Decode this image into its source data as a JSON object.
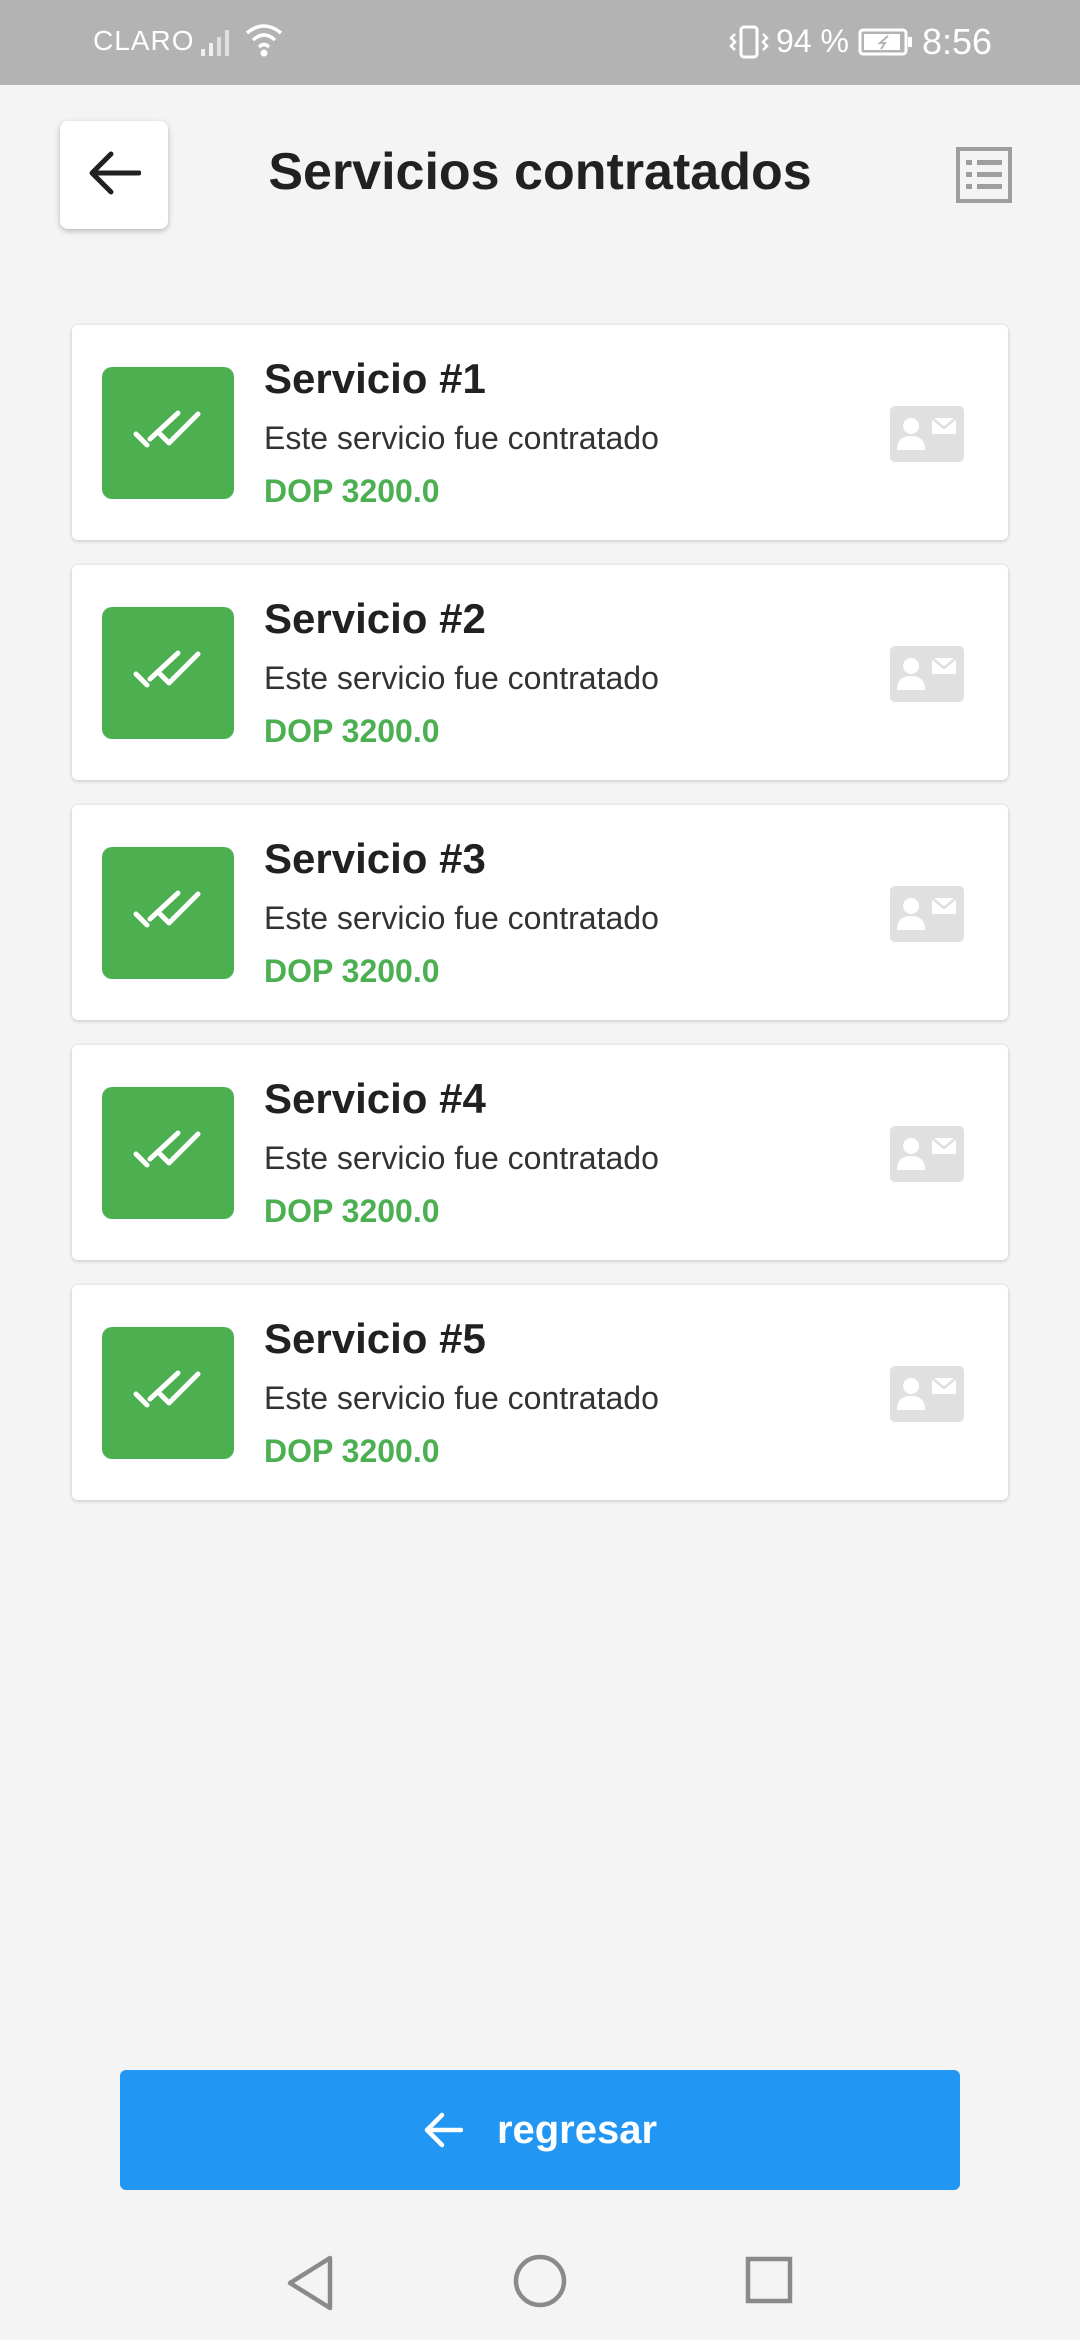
{
  "status_bar": {
    "carrier": "CLARO",
    "battery_percent": "94 %",
    "time": "8:56"
  },
  "header": {
    "title": "Servicios contratados"
  },
  "services": [
    {
      "title": "Servicio #1",
      "description": "Este servicio fue contratado",
      "price": "DOP 3200.0"
    },
    {
      "title": "Servicio #2",
      "description": "Este servicio fue contratado",
      "price": "DOP 3200.0"
    },
    {
      "title": "Servicio #3",
      "description": "Este servicio fue contratado",
      "price": "DOP 3200.0"
    },
    {
      "title": "Servicio #4",
      "description": "Este servicio fue contratado",
      "price": "DOP 3200.0"
    },
    {
      "title": "Servicio #5",
      "description": "Este servicio fue contratado",
      "price": "DOP 3200.0"
    }
  ],
  "bottom_button": {
    "label": "regresar"
  },
  "colors": {
    "accent_green": "#4caf50",
    "button_blue": "#2196f3",
    "status_bar_gray": "#b3b3b3",
    "background": "#f4f4f4"
  },
  "icons": {
    "header_back": "arrow-left-icon",
    "header_menu": "list-icon",
    "card_status": "double-check-icon",
    "card_action": "contact-card-icon",
    "button_icon": "arrow-left-icon",
    "nav": [
      "triangle-back-icon",
      "circle-home-icon",
      "square-recents-icon"
    ]
  }
}
